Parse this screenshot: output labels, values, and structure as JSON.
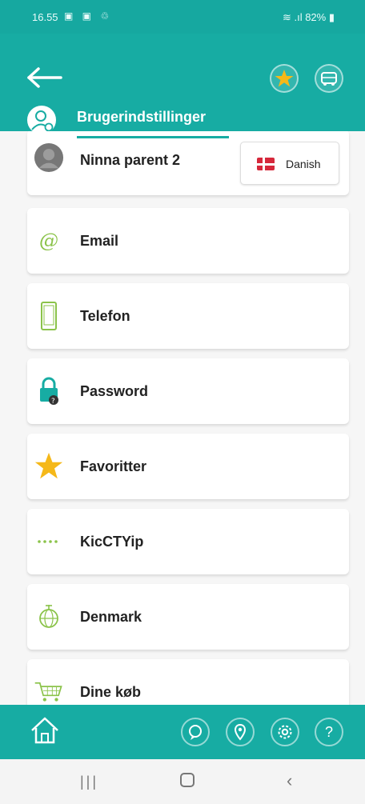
{
  "statusbar": {
    "time": "16.55",
    "icons": "▣ ▣ ♲",
    "signal_battery": "82%"
  },
  "header": {
    "title": "Brugerindstillinger"
  },
  "profile": {
    "name": "Ninna parent 2",
    "language": "Danish"
  },
  "menu": [
    {
      "label": "Email",
      "icon": "at-icon"
    },
    {
      "label": "Telefon",
      "icon": "phone-icon"
    },
    {
      "label": "Password",
      "icon": "lock-icon"
    },
    {
      "label": "Favoritter",
      "icon": "star-icon"
    },
    {
      "label": "KicCTYip",
      "icon": "dots-icon"
    },
    {
      "label": "Denmark",
      "icon": "globe-icon"
    },
    {
      "label": "Dine køb",
      "icon": "cart-icon"
    }
  ],
  "bottom_nav": {
    "help_glyph": "?"
  },
  "colors": {
    "primary": "#17aca3",
    "accent_star": "#f5b819",
    "flag_red": "#d6283b",
    "icon_green": "#8bc34a"
  }
}
